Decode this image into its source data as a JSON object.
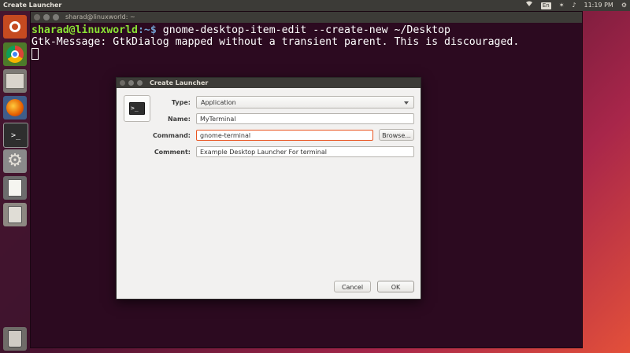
{
  "top_panel": {
    "title": "Create Launcher",
    "keyboard": "En",
    "time": "11:19 PM"
  },
  "terminal": {
    "title": "sharad@linuxworld: ~",
    "prompt_user": "sharad@linuxworld",
    "prompt_path": ":~$ ",
    "command": "gnome-desktop-item-edit --create-new ~/Desktop",
    "output": "Gtk-Message: GtkDialog mapped without a transient parent. This is discouraged."
  },
  "dialog": {
    "title": "Create Launcher",
    "type_label": "Type:",
    "type_value": "Application",
    "name_label": "Name:",
    "name_value": "MyTerminal",
    "command_label": "Command:",
    "command_value": "gnome-terminal",
    "browse_label": "Browse...",
    "comment_label": "Comment:",
    "comment_value": "Example Desktop Launcher For terminal",
    "cancel_label": "Cancel",
    "ok_label": "OK",
    "icon_glyph": ">_"
  },
  "launcher": {
    "items": [
      {
        "name": "ubuntu-dash-icon"
      },
      {
        "name": "chrome-icon"
      },
      {
        "name": "files-icon"
      },
      {
        "name": "firefox-icon"
      },
      {
        "name": "terminal-icon"
      },
      {
        "name": "system-settings-icon"
      },
      {
        "name": "text-editor-icon"
      },
      {
        "name": "software-updater-icon"
      },
      {
        "name": "trash-icon"
      }
    ]
  },
  "colors": {
    "panel": "#3c3b37",
    "terminal_bg": "#2c0a20",
    "prompt_user": "#8ae234",
    "prompt_path": "#729fcf",
    "focus_accent": "#e95420"
  }
}
